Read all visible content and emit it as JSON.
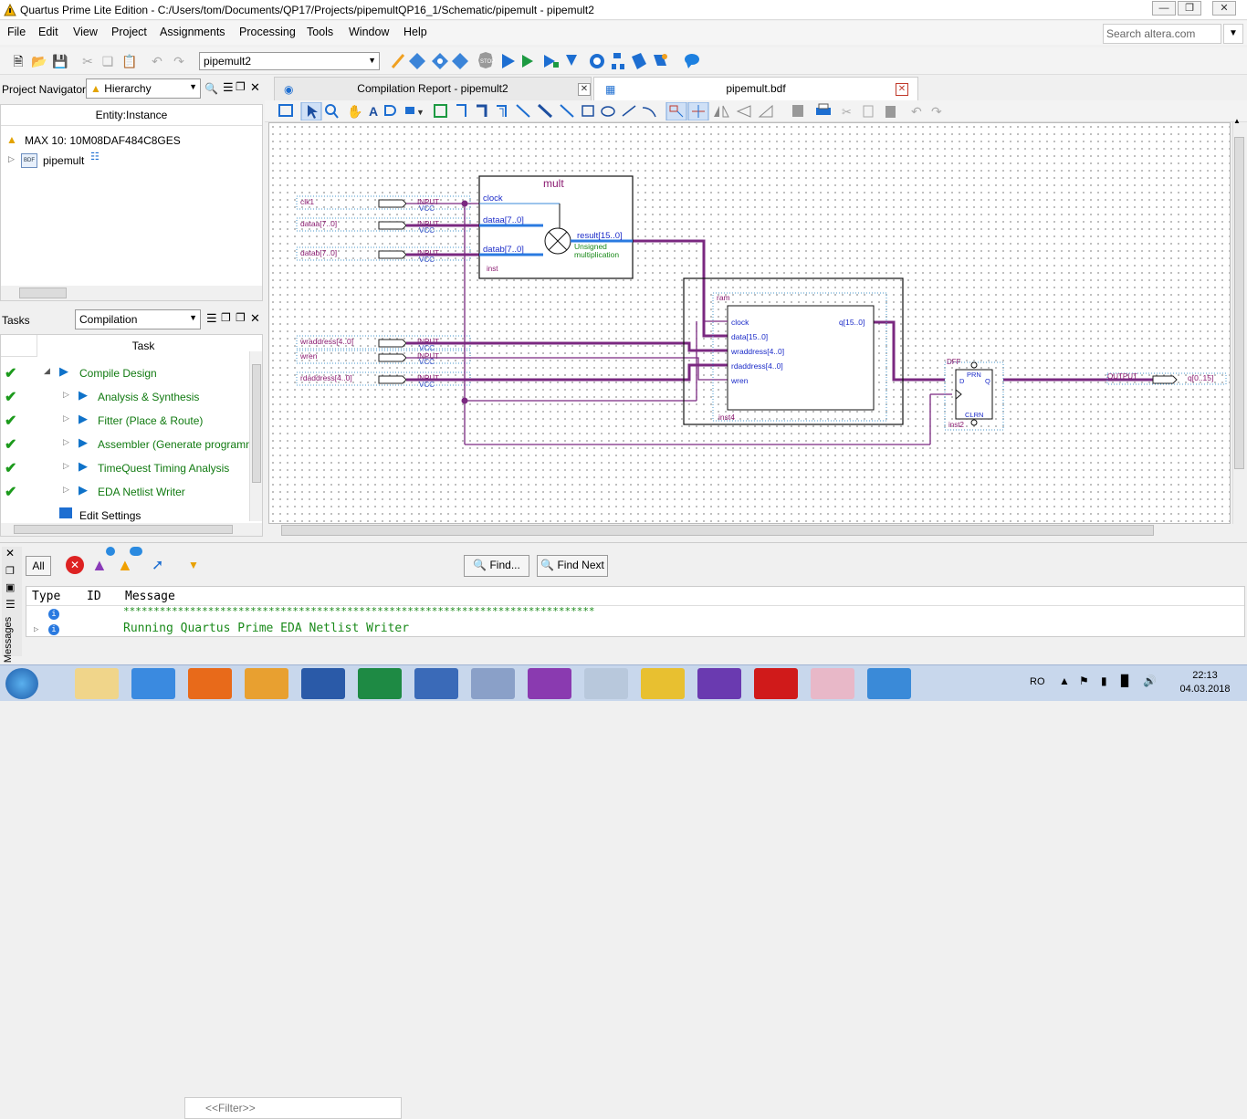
{
  "window": {
    "title": "Quartus Prime Lite Edition - C:/Users/tom/Documents/QP17/Projects/pipemultQP16_1/Schematic/pipemult - pipemult2"
  },
  "menu": [
    "File",
    "Edit",
    "View",
    "Project",
    "Assignments",
    "Processing",
    "Tools",
    "Window",
    "Help"
  ],
  "search": {
    "placeholder": "Search altera.com"
  },
  "toolbar": {
    "revision": "pipemult2"
  },
  "project_navigator": {
    "title": "Project Navigator",
    "view": "Hierarchy",
    "column": "Entity:Instance",
    "device": "MAX 10: 10M08DAF484C8GES",
    "top_entity": "pipemult",
    "bdf_badge": "BDF"
  },
  "tasks": {
    "title": "Tasks",
    "flow": "Compilation",
    "column": "Task",
    "items": [
      {
        "label": "Compile Design",
        "status": "done"
      },
      {
        "label": "Analysis & Synthesis",
        "status": "done"
      },
      {
        "label": "Fitter (Place & Route)",
        "status": "done"
      },
      {
        "label": "Assembler (Generate programm",
        "status": "done"
      },
      {
        "label": "TimeQuest Timing Analysis",
        "status": "done"
      },
      {
        "label": "EDA Netlist Writer",
        "status": "done"
      },
      {
        "label": "Edit Settings",
        "status": ""
      }
    ]
  },
  "tabs": [
    {
      "label": "Compilation Report - pipemult2",
      "active": false
    },
    {
      "label": "pipemult.bdf",
      "active": true
    }
  ],
  "schematic": {
    "inputs": [
      "clk1",
      "dataa[7..0]",
      "datab[7..0]",
      "wraddress[4..0]",
      "wren",
      "rdaddress[4..0]"
    ],
    "input_tag": "INPUT",
    "vcc": "VCC",
    "mult": {
      "name": "mult",
      "ports_in": [
        "clock",
        "dataa[7..0]",
        "datab[7..0]"
      ],
      "port_out": "result[15..0]",
      "note1": "Unsigned",
      "note2": "multiplication",
      "inst": "inst"
    },
    "ram": {
      "name": "ram",
      "ports_in": [
        "clock",
        "data[15..0]",
        "wraddress[4..0]",
        "rdaddress[4..0]",
        "wren"
      ],
      "port_out": "q[15..0]",
      "inst": "inst4"
    },
    "dff": {
      "name": "DFF",
      "prn": "PRN",
      "clrn": "CLRN",
      "d": "D",
      "q": "Q",
      "inst": "inst2"
    },
    "output": {
      "tag": "OUTPUT",
      "name": "q[0..15]"
    }
  },
  "messages": {
    "filter_all": "All",
    "filter_placeholder": "<<Filter>>",
    "find": "Find...",
    "find_next": "Find Next",
    "columns": [
      "Type",
      "ID",
      "Message"
    ],
    "rows": [
      {
        "text": "******************************************************************************"
      },
      {
        "text": "Running Quartus Prime EDA Netlist Writer"
      }
    ],
    "side_label": "Messages"
  },
  "taskbar": {
    "lang": "RO",
    "time": "22:13",
    "date": "04.03.2018"
  }
}
